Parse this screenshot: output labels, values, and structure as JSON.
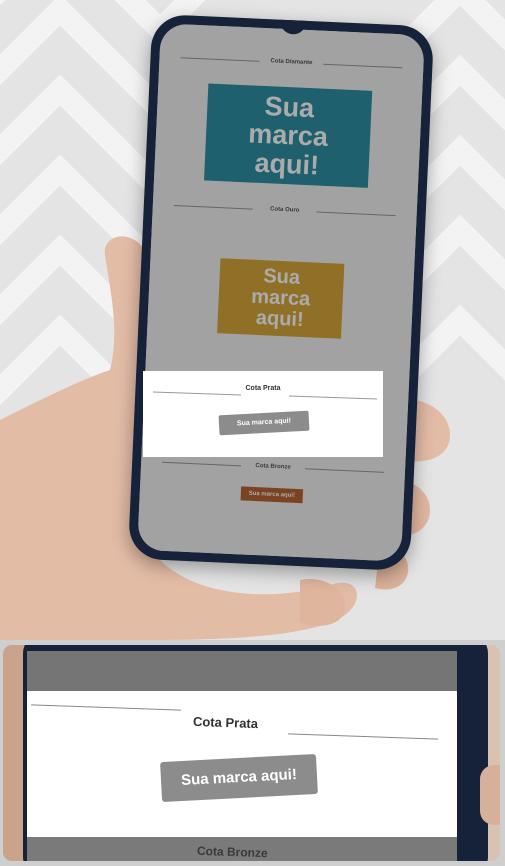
{
  "phone": {
    "tiers": [
      {
        "title": "Cota Diamante",
        "logo": "Sua marca aqui!",
        "color": "#2e8fa3"
      },
      {
        "title": "Cota Ouro",
        "logo": "Sua marca aqui!",
        "color": "#d7a73b"
      },
      {
        "title": "Cota Prata",
        "logo": "Sua marca aqui!",
        "color": "#8c8c8c"
      },
      {
        "title": "Cota Bronze",
        "logo": "Sua marca aqui!",
        "color": "#b86433"
      }
    ]
  },
  "zoom": {
    "title": "Cota Prata",
    "logo": "Sua marca aqui!",
    "next_title": "Cota Bronze"
  }
}
